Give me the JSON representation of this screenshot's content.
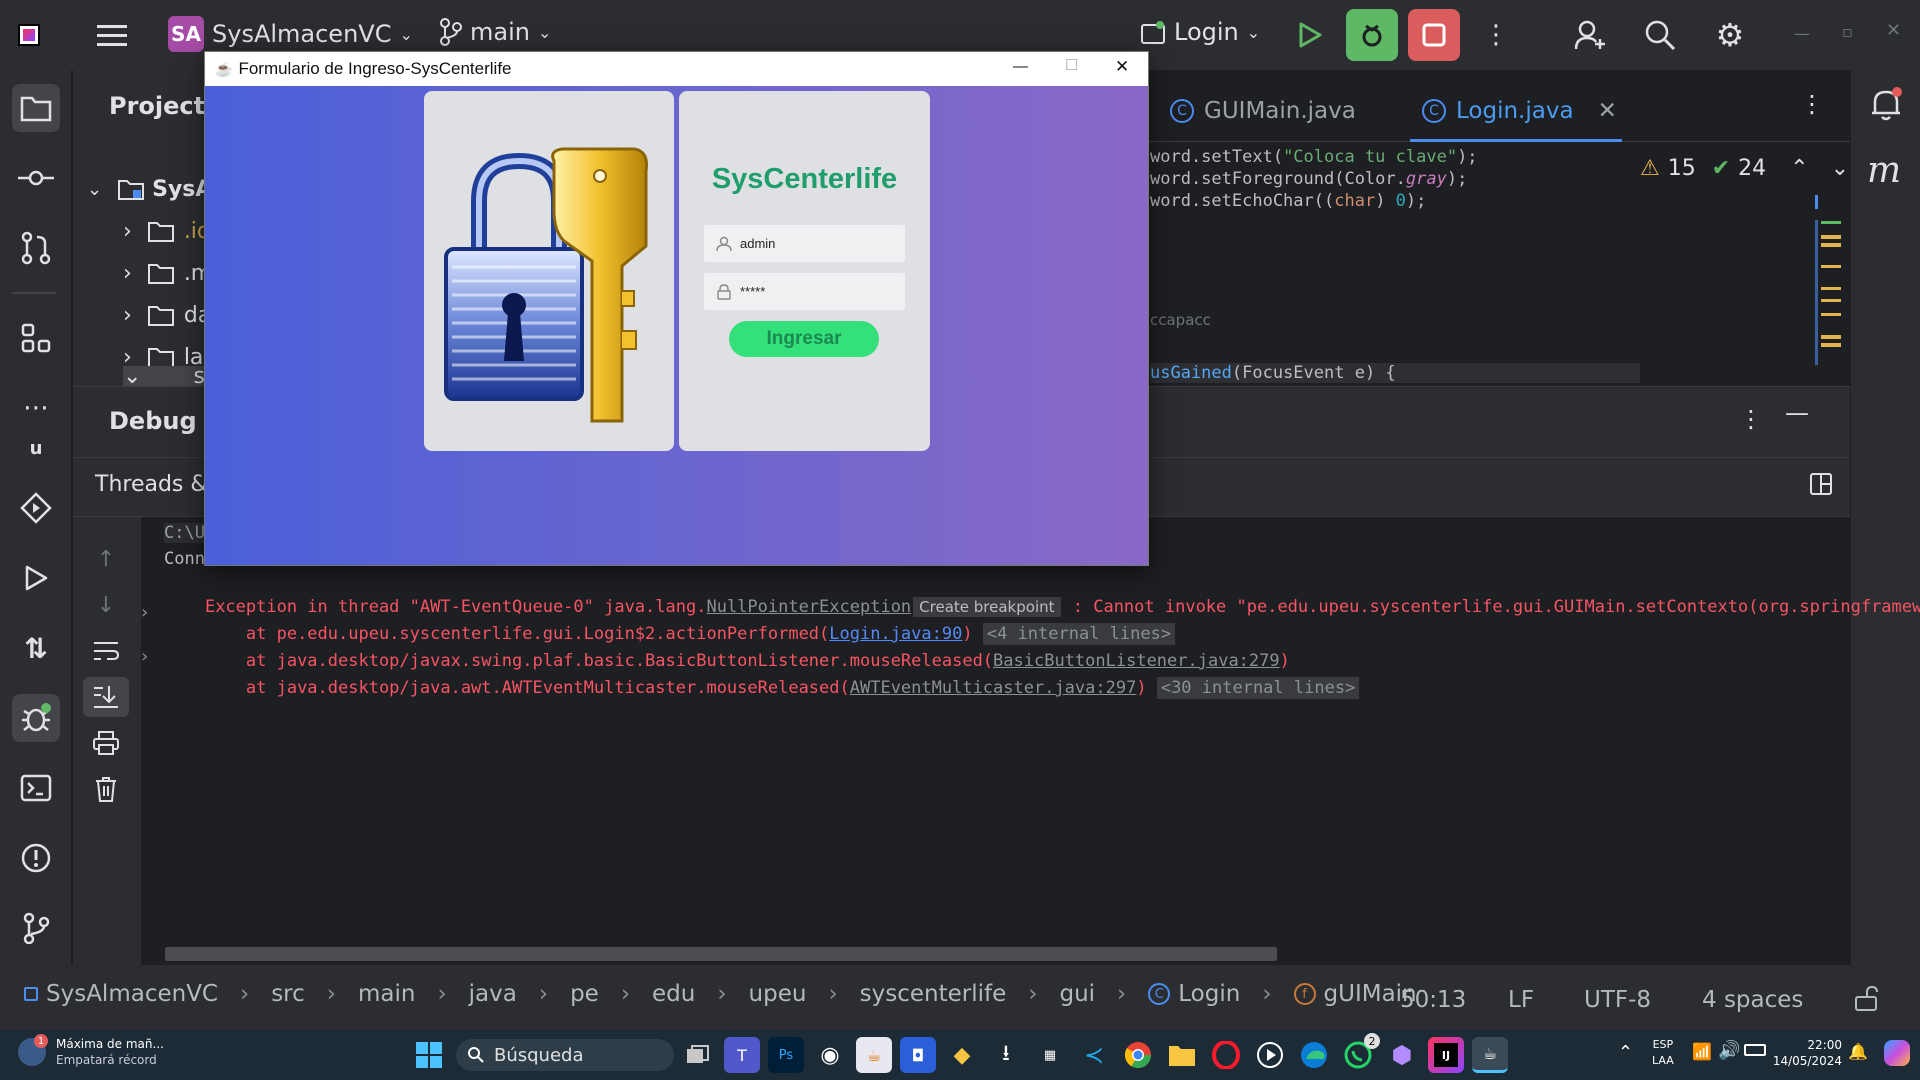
{
  "titlebar": {
    "project_initials": "SA",
    "project_name": "SysAlmacenVC",
    "branch": "main",
    "run_config": "Login"
  },
  "project_panel": {
    "title": "Project",
    "root": "SysA",
    "items": [
      ".id",
      ".m",
      "da",
      "la",
      "sr"
    ]
  },
  "editor": {
    "tabs": [
      {
        "label": "GUIMain.java",
        "active": false
      },
      {
        "label": "Login.java",
        "active": true
      }
    ],
    "inspections": {
      "warnings": "15",
      "ok": "24"
    },
    "code_lines": [
      {
        "pre": "word.setText(",
        "str": "\"Coloca tu clave\"",
        "post": ");"
      },
      {
        "pre": "word.setForeground(Color.",
        "kw": "gray",
        "post": ");"
      },
      {
        "pre": "word.setEchoChar((",
        "kw": "char",
        "post": ") ",
        "num": "0",
        "post2": ");"
      },
      {
        "hint": "ccapacc"
      },
      {
        "fn": "usGained",
        "post": "(FocusEvent e) {"
      }
    ]
  },
  "debug": {
    "title": "Debug",
    "subtitle": "Threads &",
    "console": {
      "line1": "C:\\U",
      "line2": "Conn",
      "exception_prefix": "Exception in thread \"AWT-EventQueue-0\" java.lang.",
      "exception_link": "NullPointerException",
      "create_breakpoint": "Create breakpoint",
      "exception_suffix": " : Cannot invoke \"pe.edu.upeu.syscenterlife.gui.GUIMain.setContexto(org.springframewor",
      "stack": [
        {
          "pre": "    at pe.edu.upeu.syscenterlife.gui.Login$2.actionPerformed(",
          "link": "Login.java:90",
          "post": ")",
          "fold": "<4 internal lines>"
        },
        {
          "pre": "    at java.desktop/javax.swing.plaf.basic.BasicButtonListener.mouseReleased(",
          "link": "BasicButtonListener.java:279",
          "post": ")",
          "fold": ""
        },
        {
          "pre": "    at java.desktop/java.awt.AWTEventMulticaster.mouseReleased(",
          "link": "AWTEventMulticaster.java:297",
          "post": ")",
          "fold": "<30 internal lines>"
        }
      ]
    }
  },
  "breadcrumb": [
    "SysAlmacenVC",
    "src",
    "main",
    "java",
    "pe",
    "edu",
    "upeu",
    "syscenterlife",
    "gui",
    "Login",
    "gUIMain"
  ],
  "status": {
    "position": "50:13",
    "line_ending": "LF",
    "encoding": "UTF-8",
    "indent": "4 spaces"
  },
  "swing_window": {
    "title": "Formulario de Ingreso-SysCenterlife",
    "brand": "SysCenterlife",
    "username": "admin",
    "password": "*****",
    "submit": "Ingresar",
    "brand_color": "#1f9e6b",
    "button_color": "#33e07a"
  },
  "taskbar": {
    "notification_title": "Máxima de mañ...",
    "notification_sub": "Empatará récord",
    "search_placeholder": "Búsqueda",
    "lang": "ESP",
    "lang2": "LAA",
    "time": "22:00",
    "date": "14/05/2024",
    "whatsapp_badge": "2"
  }
}
